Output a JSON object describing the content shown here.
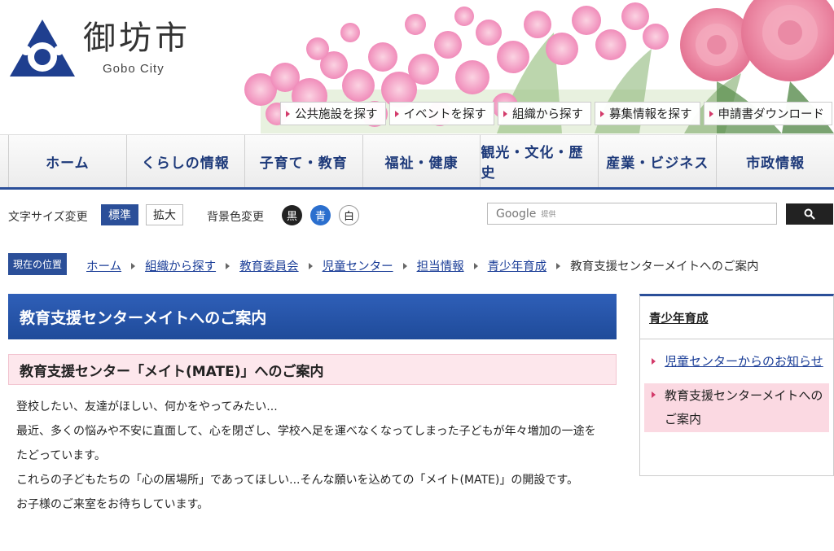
{
  "site": {
    "name_jp": "御坊市",
    "name_en": "Gobo City"
  },
  "quicklinks": [
    {
      "label": "公共施設を探す"
    },
    {
      "label": "イベントを探す"
    },
    {
      "label": "組織から探す"
    },
    {
      "label": "募集情報を探す"
    },
    {
      "label": "申請書ダウンロード"
    }
  ],
  "nav": [
    {
      "label": "ホーム"
    },
    {
      "label": "くらしの情報"
    },
    {
      "label": "子育て・教育"
    },
    {
      "label": "福祉・健康"
    },
    {
      "label": "観光・文化・歴史"
    },
    {
      "label": "産業・ビジネス"
    },
    {
      "label": "市政情報"
    }
  ],
  "tools": {
    "font_size_label": "文字サイズ変更",
    "font_standard": "標準",
    "font_large": "拡大",
    "bg_label": "背景色変更",
    "bg_black": "黒",
    "bg_blue": "青",
    "bg_white": "白",
    "search_placeholder": "Google",
    "search_placeholder_sub": "提供"
  },
  "breadcrumb": {
    "here_label": "現在の位置",
    "links": [
      "ホーム",
      "組織から探す",
      "教育委員会",
      "児童センター",
      "担当情報",
      "青少年育成"
    ],
    "current": "教育支援センターメイトへのご案内"
  },
  "main": {
    "title": "教育支援センターメイトへのご案内",
    "subtitle": "教育支援センター「メイト(MATE)」へのご案内",
    "paragraphs": [
      "登校したい、友達がほしい、何かをやってみたい...",
      "最近、多くの悩みや不安に直面して、心を閉ざし、学校へ足を運べなくなってしまった子どもが年々増加の一途をたどっています。",
      "これらの子どもたちの「心の居場所」であってほしい...そんな願いを込めての「メイト(MATE)」の開設です。",
      "お子様のご来室をお待ちしています。"
    ]
  },
  "sidebar": {
    "heading": "青少年育成",
    "items": [
      {
        "label": "児童センターからのお知らせ"
      },
      {
        "label": "教育支援センターメイトへのご案内"
      }
    ]
  },
  "colors": {
    "brand_blue": "#2b4f99",
    "accent_pink": "#d33a6a",
    "highlight_pink": "#fde7ec"
  }
}
